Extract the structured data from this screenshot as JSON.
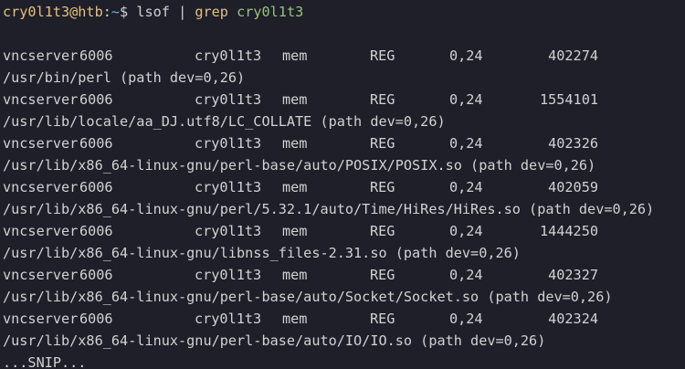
{
  "prompt": {
    "user_host": "cry0l1t3@htb",
    "separator": ":",
    "path": "~",
    "symbol": "$ ",
    "command": "lsof",
    "pipe": " | ",
    "grep": "grep",
    "grep_arg": "cry0l1t3"
  },
  "entries": [
    {
      "command": "vncserver",
      "pid": "6006",
      "user": "cry0l1t3",
      "fd": "mem",
      "type": "REG",
      "device": "0,24",
      "node": "402274",
      "path": "/usr/bin/perl (path dev=0,26)"
    },
    {
      "command": "vncserver",
      "pid": "6006",
      "user": "cry0l1t3",
      "fd": "mem",
      "type": "REG",
      "device": "0,24",
      "node": "1554101",
      "path": "/usr/lib/locale/aa_DJ.utf8/LC_COLLATE (path dev=0,26)"
    },
    {
      "command": "vncserver",
      "pid": "6006",
      "user": "cry0l1t3",
      "fd": "mem",
      "type": "REG",
      "device": "0,24",
      "node": "402326",
      "path": "/usr/lib/x86_64-linux-gnu/perl-base/auto/POSIX/POSIX.so (path dev=0,26)"
    },
    {
      "command": "vncserver",
      "pid": "6006",
      "user": "cry0l1t3",
      "fd": "mem",
      "type": "REG",
      "device": "0,24",
      "node": "402059",
      "path": "/usr/lib/x86_64-linux-gnu/perl/5.32.1/auto/Time/HiRes/HiRes.so (path dev=0,26)"
    },
    {
      "command": "vncserver",
      "pid": "6006",
      "user": "cry0l1t3",
      "fd": "mem",
      "type": "REG",
      "device": "0,24",
      "node": "1444250",
      "path": "/usr/lib/x86_64-linux-gnu/libnss_files-2.31.so (path dev=0,26)"
    },
    {
      "command": "vncserver",
      "pid": "6006",
      "user": "cry0l1t3",
      "fd": "mem",
      "type": "REG",
      "device": "0,24",
      "node": "402327",
      "path": "/usr/lib/x86_64-linux-gnu/perl-base/auto/Socket/Socket.so (path dev=0,26)"
    },
    {
      "command": "vncserver",
      "pid": "6006",
      "user": "cry0l1t3",
      "fd": "mem",
      "type": "REG",
      "device": "0,24",
      "node": "402324",
      "path": "/usr/lib/x86_64-linux-gnu/perl-base/auto/IO/IO.so (path dev=0,26)"
    }
  ],
  "footer": "...SNIP...",
  "colors": {
    "background": "#1e1f29",
    "text": "#d2d2d2",
    "prompt_user": "#e6c07b",
    "prompt_path": "#61afef",
    "grep_arg": "#98c379"
  }
}
